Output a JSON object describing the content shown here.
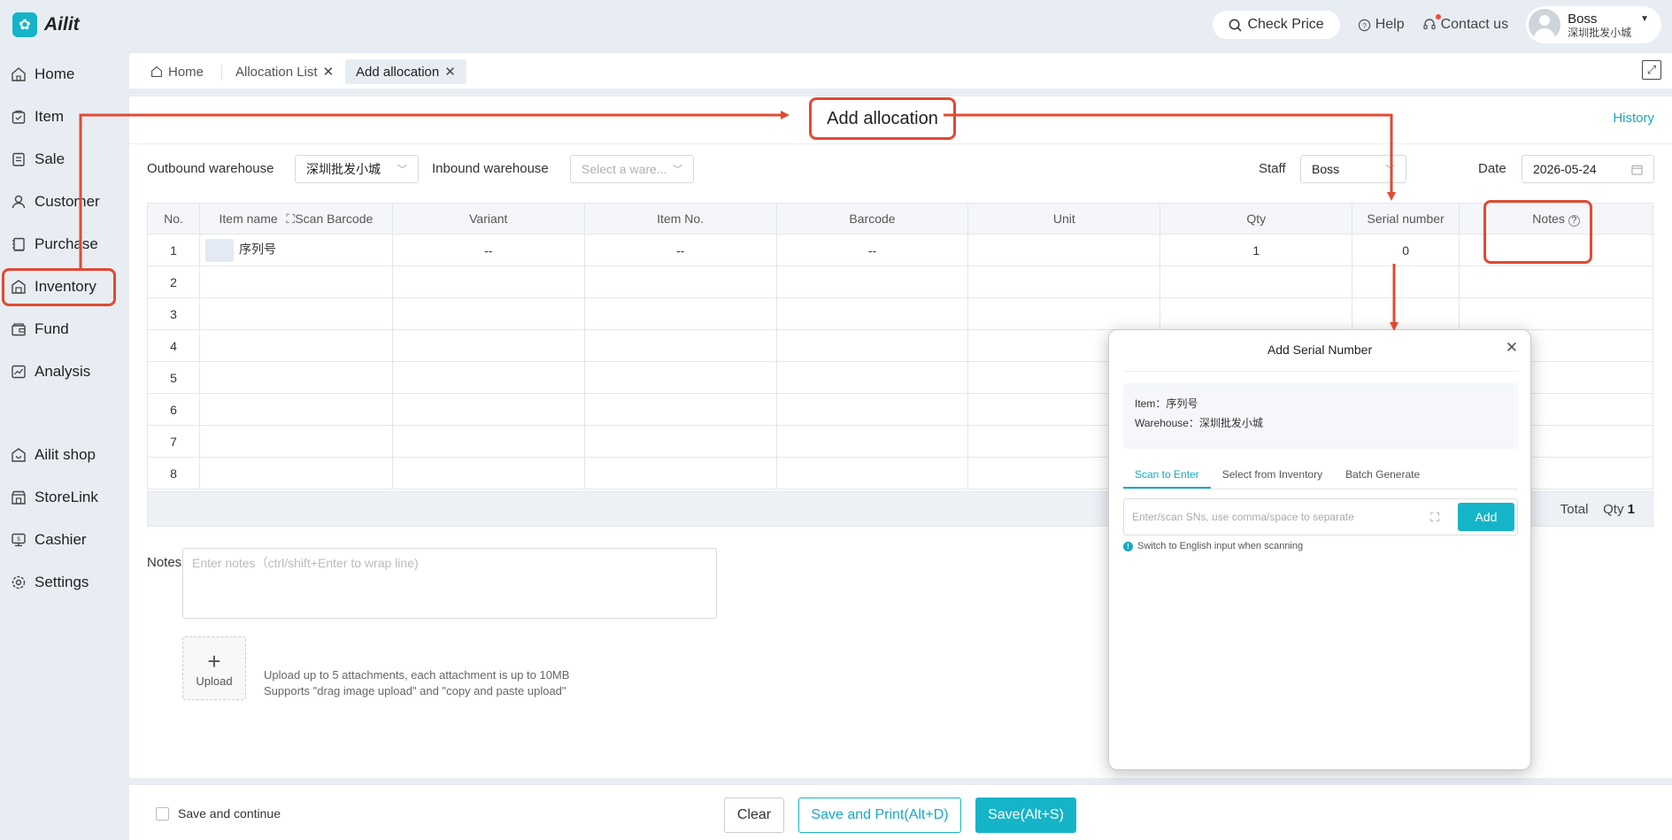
{
  "app": {
    "name": "Ailit",
    "logo_glyph": "✿"
  },
  "topbar": {
    "check_price": "Check Price",
    "help": "Help",
    "contact": "Contact us",
    "user_name": "Boss",
    "user_shop": "深圳批发小城"
  },
  "sidebar": {
    "items": [
      {
        "label": "Home",
        "icon": "home-icon"
      },
      {
        "label": "Item",
        "icon": "item-icon"
      },
      {
        "label": "Sale",
        "icon": "sale-icon"
      },
      {
        "label": "Customer",
        "icon": "customer-icon"
      },
      {
        "label": "Purchase",
        "icon": "purchase-icon"
      },
      {
        "label": "Inventory",
        "icon": "inventory-icon"
      },
      {
        "label": "Fund",
        "icon": "fund-icon"
      },
      {
        "label": "Analysis",
        "icon": "analysis-icon"
      },
      {
        "label": "Ailit shop",
        "icon": "shop-icon"
      },
      {
        "label": "StoreLink",
        "icon": "storelink-icon"
      },
      {
        "label": "Cashier",
        "icon": "cashier-icon"
      },
      {
        "label": "Settings",
        "icon": "settings-icon"
      }
    ]
  },
  "tabs": [
    {
      "label": "Home"
    },
    {
      "label": "Allocation List",
      "close": "✕"
    },
    {
      "label": "Add allocation",
      "close": "✕"
    }
  ],
  "page": {
    "title": "Add allocation",
    "history": "History",
    "outbound_label": "Outbound warehouse",
    "outbound_value": "深圳批发小城",
    "inbound_label": "Inbound warehouse",
    "inbound_placeholder": "Select a ware...",
    "staff_label": "Staff",
    "staff_value": "Boss",
    "date_label": "Date",
    "date_value": "2026-05-24"
  },
  "table": {
    "columns": {
      "no": "No.",
      "item_name": "Item name",
      "scan_barcode": "Scan Barcode",
      "variant": "Variant",
      "item_no": "Item No.",
      "barcode": "Barcode",
      "unit": "Unit",
      "qty": "Qty",
      "serial": "Serial number",
      "notes": "Notes"
    },
    "row1": {
      "no": "1",
      "name": "序列号",
      "variant": "--",
      "item_no": "--",
      "barcode": "--",
      "unit": "",
      "qty": "1",
      "serial": "0",
      "notes": ""
    },
    "row_numbers": [
      "2",
      "3",
      "4",
      "5",
      "6",
      "7",
      "8"
    ],
    "total_label": "Total",
    "qty_label": "Qty",
    "qty_total": "1"
  },
  "notes": {
    "label": "Notes",
    "placeholder": "Enter notes（ctrl/shift+Enter to wrap line)"
  },
  "upload": {
    "plus": "+",
    "label": "Upload",
    "hint1": "Upload up to 5 attachments, each attachment is up to 10MB",
    "hint2": "Supports \"drag image upload\" and \"copy and paste upload\""
  },
  "footer": {
    "save_continue": "Save and continue",
    "clear": "Clear",
    "save_print": "Save and Print(Alt+D)",
    "save": "Save(Alt+S)"
  },
  "dialog": {
    "title": "Add Serial Number",
    "close": "✕",
    "item_line": "Item：序列号",
    "warehouse_line": "Warehouse：深圳批发小城",
    "tabs": [
      "Scan to Enter",
      "Select from Inventory",
      "Batch Generate"
    ],
    "input_placeholder": "Enter/scan SNs, use comma/space to separate",
    "add": "Add",
    "hint": "Switch to English input when scanning"
  },
  "colors": {
    "accent": "#16b4c8",
    "highlight": "#e04a33",
    "background": "#e8edf4"
  }
}
